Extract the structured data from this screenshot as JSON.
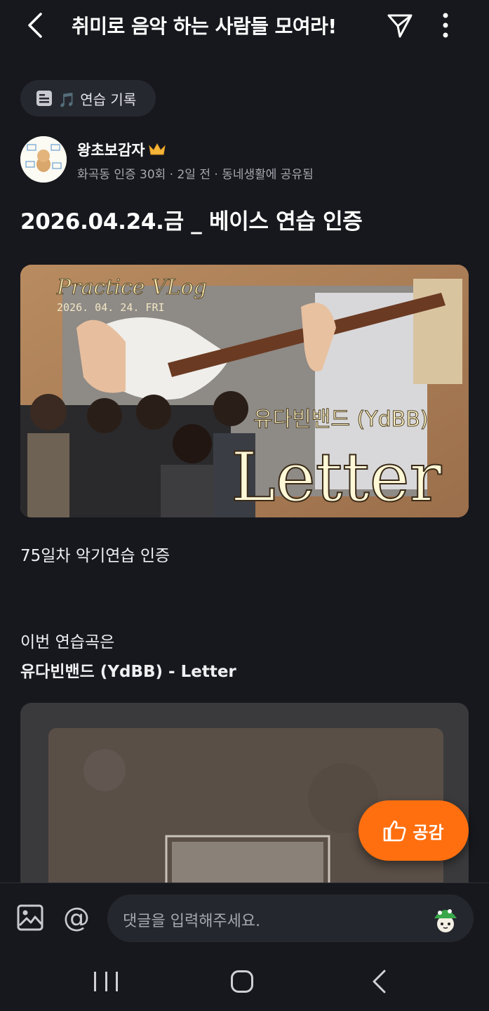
{
  "header": {
    "title": "취미로 음악 하는 사람들 모여라!"
  },
  "category": {
    "label": "🎵 연습 기록"
  },
  "author": {
    "name": "왕초보감자",
    "meta": "화곡동 인증 30회 · 2일 전 · 동네생활에 공유됨"
  },
  "post": {
    "title": "2026.04.24.금 _ 베이스 연습 인증",
    "thumbnail1": {
      "vlog_title": "Practice VLog",
      "vlog_date": "2026. 04. 24. FRI",
      "band_name": "유다빈밴드 (YdBB)",
      "song_title": "Letter"
    },
    "line1": "75일차 악기연습 인증",
    "line2": "이번 연습곡은",
    "line3": "유다빈밴드 (YdBB) - Letter"
  },
  "like_button": {
    "label": "공감"
  },
  "comment": {
    "placeholder": "댓글을 입력해주세요."
  },
  "colors": {
    "background": "#17181d",
    "accent": "#ff6f0f",
    "chip": "#262830",
    "muted_text": "#a6a8b0"
  }
}
